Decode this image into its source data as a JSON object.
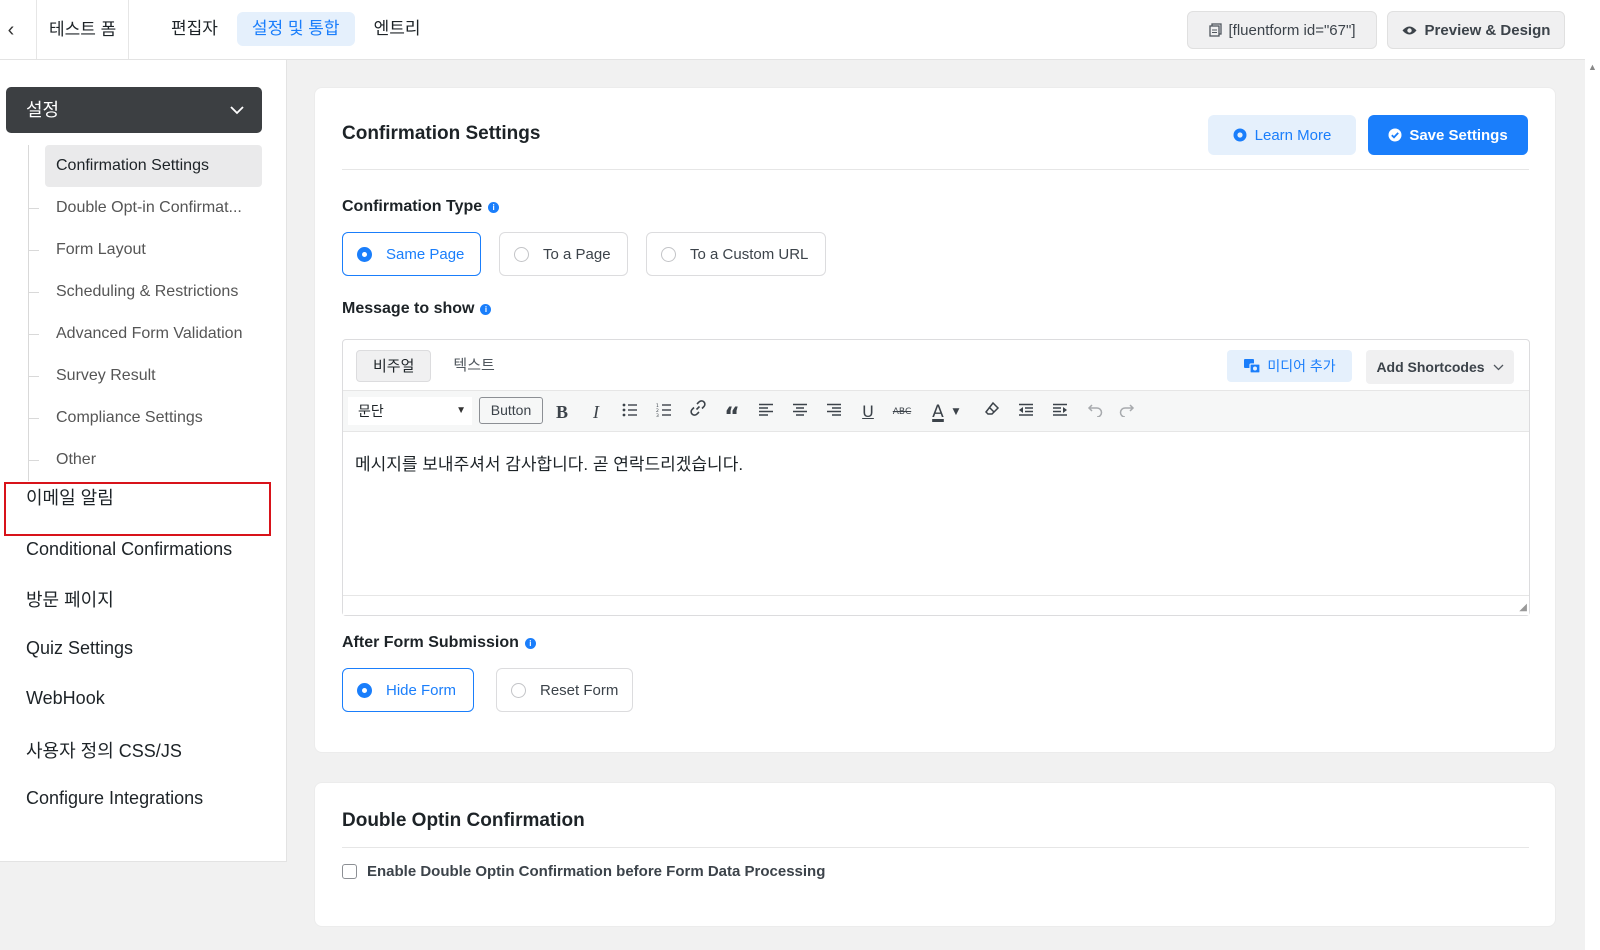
{
  "topbar": {
    "back_icon": "chevron-left-icon",
    "form_title": "테스트 폼",
    "tabs": [
      {
        "label": "편집자"
      },
      {
        "label": "설정 및 통합",
        "active": true
      },
      {
        "label": "엔트리"
      }
    ],
    "shortcode_label": "[fluentform id=\"67\"]",
    "preview_label": "Preview & Design"
  },
  "sidebar": {
    "settings_label": "설정",
    "sub_items": [
      {
        "label": "Confirmation Settings",
        "active": true
      },
      {
        "label": "Double Opt-in Confirmat..."
      },
      {
        "label": "Form Layout"
      },
      {
        "label": "Scheduling & Restrictions"
      },
      {
        "label": "Advanced Form Validation"
      },
      {
        "label": "Survey Result"
      },
      {
        "label": "Compliance Settings"
      },
      {
        "label": "Other"
      }
    ],
    "nav_items": [
      {
        "label": "이메일 알림",
        "highlighted": true
      },
      {
        "label": "Conditional Confirmations"
      },
      {
        "label": "방문 페이지"
      },
      {
        "label": "Quiz Settings"
      },
      {
        "label": "WebHook"
      },
      {
        "label": "사용자 정의 CSS/JS"
      },
      {
        "label": "Configure Integrations"
      }
    ]
  },
  "confirmation": {
    "title": "Confirmation Settings",
    "learn_more_label": "Learn More",
    "save_label": "Save Settings",
    "type_label": "Confirmation Type",
    "type_options": [
      {
        "label": "Same Page",
        "checked": true
      },
      {
        "label": "To a Page"
      },
      {
        "label": "To a Custom URL"
      }
    ],
    "message_label": "Message to show",
    "editor": {
      "tab_visual": "비주얼",
      "tab_text": "텍스트",
      "media_label": "미디어 추가",
      "shortcodes_label": "Add Shortcodes",
      "format_value": "문단",
      "button_label": "Button",
      "content": "메시지를 보내주셔서 감사합니다. 곧 연락드리겠습니다."
    },
    "after_label": "After Form Submission",
    "after_options": [
      {
        "label": "Hide Form",
        "checked": true
      },
      {
        "label": "Reset Form"
      }
    ]
  },
  "double_optin": {
    "title": "Double Optin Confirmation",
    "checkbox_label": "Enable Double Optin Confirmation before Form Data Processing",
    "checked": false
  },
  "colors": {
    "accent": "#1a7efb",
    "highlight_border": "#d8131a",
    "dropdown_bg": "#3c3f42"
  }
}
